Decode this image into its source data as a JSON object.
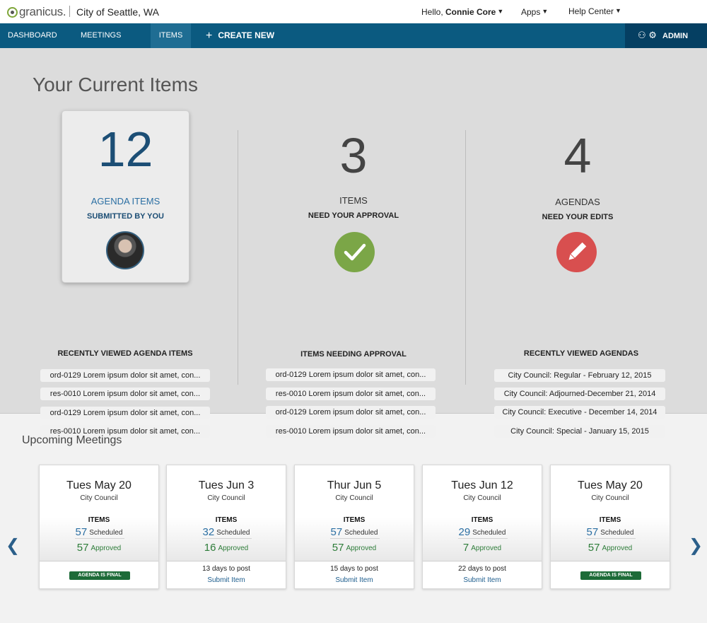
{
  "header": {
    "logo_text": "granicus.",
    "city": "City of Seattle, WA",
    "hello_prefix": "Hello, ",
    "user_name": "Connie Core",
    "apps_label": "Apps",
    "help_label": "Help Center",
    "caret": "▼"
  },
  "nav": {
    "items": [
      "DASHBOARD",
      "MEETINGS",
      "ITEMS"
    ],
    "create_plus": "+",
    "create_label": "CREATE NEW",
    "admin_icons": "⚇ ⚙",
    "admin_label": "ADMIN"
  },
  "current": {
    "title": "Your Current Items",
    "col1": {
      "number": "12",
      "label": "AGENDA ITEMS",
      "sub": "SUBMITTED BY YOU",
      "list_title": "RECENTLY VIEWED AGENDA ITEMS",
      "list": [
        "ord-0129 Lorem ipsum dolor sit amet, con...",
        "res-0010 Lorem ipsum dolor sit amet, con...",
        "ord-0129 Lorem ipsum dolor sit amet, con...",
        "res-0010 Lorem ipsum dolor sit amet, con..."
      ]
    },
    "col2": {
      "number": "3",
      "label": "ITEMS",
      "sub": "NEED YOUR APPROVAL",
      "list_title": "ITEMS NEEDING APPROVAL",
      "list": [
        "ord-0129 Lorem ipsum dolor sit amet, con...",
        "res-0010 Lorem ipsum dolor sit amet, con...",
        "ord-0129 Lorem ipsum dolor sit amet, con...",
        "res-0010 Lorem ipsum dolor sit amet, con..."
      ]
    },
    "col3": {
      "number": "4",
      "label": "AGENDAS",
      "sub": "NEED YOUR EDITS",
      "list_title": "RECENTLY VIEWED AGENDAS",
      "list": [
        "City Council: Regular - February 12, 2015",
        "City Council: Adjourned-December 21, 2014",
        "City Council: Executive - December 14, 2014",
        "City Council: Special - January 15, 2015"
      ]
    }
  },
  "upcoming": {
    "title": "Upcoming Meetings",
    "items_label": "ITEMS",
    "scheduled_label": "Scheduled",
    "approved_label": "Approved",
    "meetings": [
      {
        "date": "Tues May 20",
        "body": "City Council",
        "scheduled": "57",
        "approved": "57",
        "final": "AGENDA IS FINAL"
      },
      {
        "date": "Tues Jun 3",
        "body": "City Council",
        "scheduled": "32",
        "approved": "16",
        "days": "13 days to post",
        "submit": "Submit Item"
      },
      {
        "date": "Thur Jun 5",
        "body": "City Council",
        "scheduled": "57",
        "approved": "57",
        "days": "15 days to post",
        "submit": "Submit Item"
      },
      {
        "date": "Tues Jun 12",
        "body": "City Council",
        "scheduled": "29",
        "approved": "7",
        "days": "22 days to post",
        "submit": "Submit Item"
      },
      {
        "date": "Tues May 20",
        "body": "City Council",
        "scheduled": "57",
        "approved": "57",
        "final": "AGENDA IS FINAL"
      }
    ],
    "prev_arrow": "❮",
    "next_arrow": "❯"
  },
  "colors": {
    "nav_bg": "#0b5a80",
    "admin_bg": "#053f62",
    "check_green": "#7ba647",
    "edit_red": "#d84f4f",
    "final_green": "#1d6b38",
    "accent_blue": "#1c4e75"
  }
}
